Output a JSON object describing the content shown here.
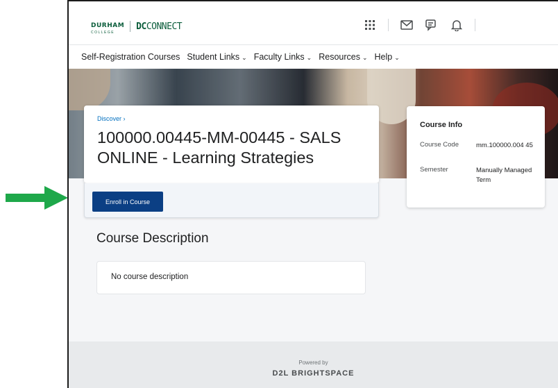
{
  "header": {
    "logo_durham": "DURHAM",
    "logo_college": "COLLEGE",
    "logo_dc": "DC",
    "logo_connect": "CONNECT",
    "icons": [
      "apps-grid-icon",
      "mail-icon",
      "chat-icon",
      "bell-icon"
    ]
  },
  "nav": {
    "items": [
      {
        "label": "Self-Registration Courses",
        "dropdown": false
      },
      {
        "label": "Student Links",
        "dropdown": true
      },
      {
        "label": "Faculty Links",
        "dropdown": true
      },
      {
        "label": "Resources",
        "dropdown": true
      },
      {
        "label": "Help",
        "dropdown": true
      }
    ],
    "chevron": "⌄"
  },
  "course": {
    "breadcrumb": "Discover ›",
    "title": "100000.00445-MM-00445 - SALS ONLINE - Learning Strategies",
    "enroll_label": "Enroll in Course"
  },
  "info": {
    "title": "Course Info",
    "code_label": "Course Code",
    "code_value": "mm.100000.004 45",
    "semester_label": "Semester",
    "semester_value": "Manually Managed Term"
  },
  "description": {
    "heading": "Course Description",
    "text": "No course description"
  },
  "footer": {
    "powered": "Powered by",
    "brand": "D2L BRIGHTSPACE"
  },
  "colors": {
    "accent": "#0b3f84",
    "arrow": "#1ea84a",
    "brand_green": "#0b5d3b"
  }
}
